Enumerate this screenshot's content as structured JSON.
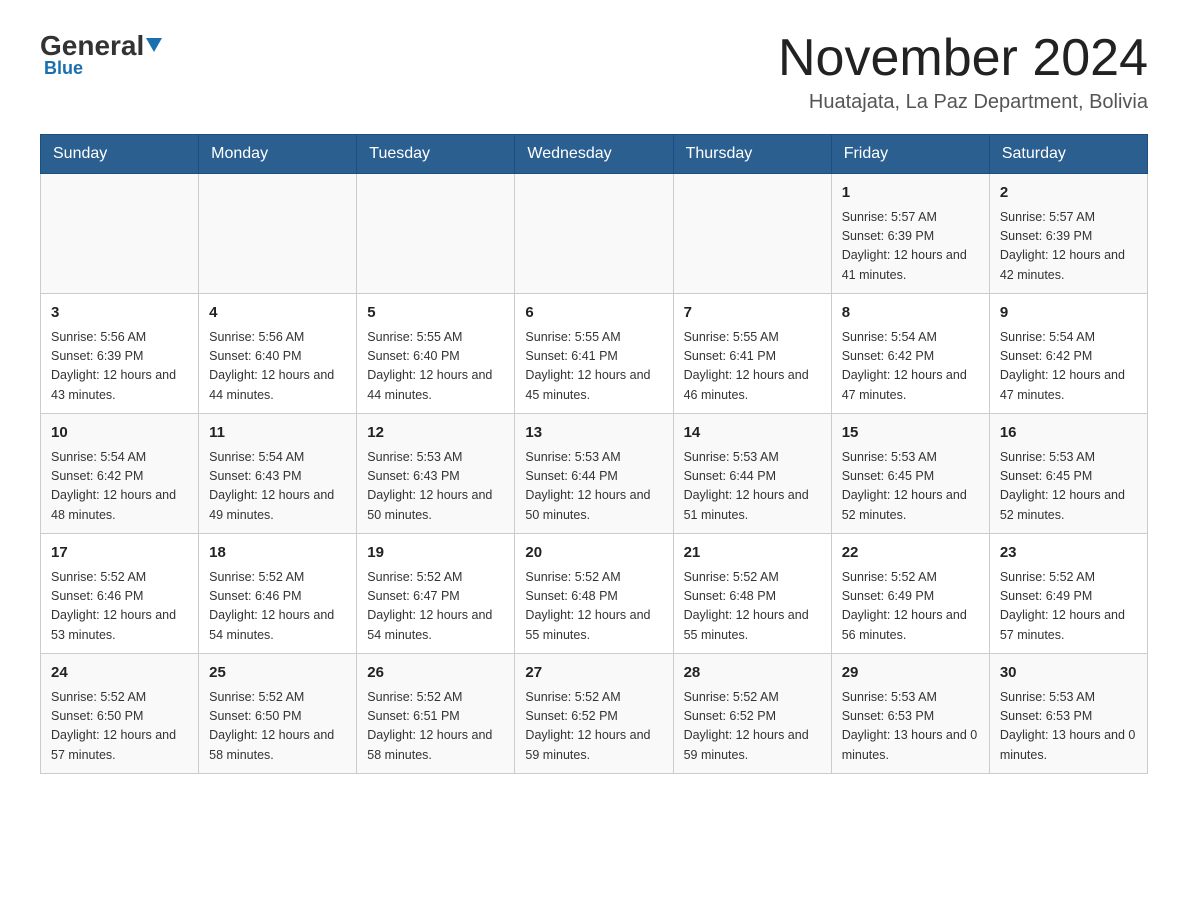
{
  "logo": {
    "text_general": "General",
    "text_blue": "Blue",
    "subtitle": "Blue"
  },
  "header": {
    "title": "November 2024",
    "subtitle": "Huatajata, La Paz Department, Bolivia"
  },
  "calendar": {
    "days_of_week": [
      "Sunday",
      "Monday",
      "Tuesday",
      "Wednesday",
      "Thursday",
      "Friday",
      "Saturday"
    ],
    "weeks": [
      [
        {
          "day": "",
          "info": ""
        },
        {
          "day": "",
          "info": ""
        },
        {
          "day": "",
          "info": ""
        },
        {
          "day": "",
          "info": ""
        },
        {
          "day": "",
          "info": ""
        },
        {
          "day": "1",
          "info": "Sunrise: 5:57 AM\nSunset: 6:39 PM\nDaylight: 12 hours and 41 minutes."
        },
        {
          "day": "2",
          "info": "Sunrise: 5:57 AM\nSunset: 6:39 PM\nDaylight: 12 hours and 42 minutes."
        }
      ],
      [
        {
          "day": "3",
          "info": "Sunrise: 5:56 AM\nSunset: 6:39 PM\nDaylight: 12 hours and 43 minutes."
        },
        {
          "day": "4",
          "info": "Sunrise: 5:56 AM\nSunset: 6:40 PM\nDaylight: 12 hours and 44 minutes."
        },
        {
          "day": "5",
          "info": "Sunrise: 5:55 AM\nSunset: 6:40 PM\nDaylight: 12 hours and 44 minutes."
        },
        {
          "day": "6",
          "info": "Sunrise: 5:55 AM\nSunset: 6:41 PM\nDaylight: 12 hours and 45 minutes."
        },
        {
          "day": "7",
          "info": "Sunrise: 5:55 AM\nSunset: 6:41 PM\nDaylight: 12 hours and 46 minutes."
        },
        {
          "day": "8",
          "info": "Sunrise: 5:54 AM\nSunset: 6:42 PM\nDaylight: 12 hours and 47 minutes."
        },
        {
          "day": "9",
          "info": "Sunrise: 5:54 AM\nSunset: 6:42 PM\nDaylight: 12 hours and 47 minutes."
        }
      ],
      [
        {
          "day": "10",
          "info": "Sunrise: 5:54 AM\nSunset: 6:42 PM\nDaylight: 12 hours and 48 minutes."
        },
        {
          "day": "11",
          "info": "Sunrise: 5:54 AM\nSunset: 6:43 PM\nDaylight: 12 hours and 49 minutes."
        },
        {
          "day": "12",
          "info": "Sunrise: 5:53 AM\nSunset: 6:43 PM\nDaylight: 12 hours and 50 minutes."
        },
        {
          "day": "13",
          "info": "Sunrise: 5:53 AM\nSunset: 6:44 PM\nDaylight: 12 hours and 50 minutes."
        },
        {
          "day": "14",
          "info": "Sunrise: 5:53 AM\nSunset: 6:44 PM\nDaylight: 12 hours and 51 minutes."
        },
        {
          "day": "15",
          "info": "Sunrise: 5:53 AM\nSunset: 6:45 PM\nDaylight: 12 hours and 52 minutes."
        },
        {
          "day": "16",
          "info": "Sunrise: 5:53 AM\nSunset: 6:45 PM\nDaylight: 12 hours and 52 minutes."
        }
      ],
      [
        {
          "day": "17",
          "info": "Sunrise: 5:52 AM\nSunset: 6:46 PM\nDaylight: 12 hours and 53 minutes."
        },
        {
          "day": "18",
          "info": "Sunrise: 5:52 AM\nSunset: 6:46 PM\nDaylight: 12 hours and 54 minutes."
        },
        {
          "day": "19",
          "info": "Sunrise: 5:52 AM\nSunset: 6:47 PM\nDaylight: 12 hours and 54 minutes."
        },
        {
          "day": "20",
          "info": "Sunrise: 5:52 AM\nSunset: 6:48 PM\nDaylight: 12 hours and 55 minutes."
        },
        {
          "day": "21",
          "info": "Sunrise: 5:52 AM\nSunset: 6:48 PM\nDaylight: 12 hours and 55 minutes."
        },
        {
          "day": "22",
          "info": "Sunrise: 5:52 AM\nSunset: 6:49 PM\nDaylight: 12 hours and 56 minutes."
        },
        {
          "day": "23",
          "info": "Sunrise: 5:52 AM\nSunset: 6:49 PM\nDaylight: 12 hours and 57 minutes."
        }
      ],
      [
        {
          "day": "24",
          "info": "Sunrise: 5:52 AM\nSunset: 6:50 PM\nDaylight: 12 hours and 57 minutes."
        },
        {
          "day": "25",
          "info": "Sunrise: 5:52 AM\nSunset: 6:50 PM\nDaylight: 12 hours and 58 minutes."
        },
        {
          "day": "26",
          "info": "Sunrise: 5:52 AM\nSunset: 6:51 PM\nDaylight: 12 hours and 58 minutes."
        },
        {
          "day": "27",
          "info": "Sunrise: 5:52 AM\nSunset: 6:52 PM\nDaylight: 12 hours and 59 minutes."
        },
        {
          "day": "28",
          "info": "Sunrise: 5:52 AM\nSunset: 6:52 PM\nDaylight: 12 hours and 59 minutes."
        },
        {
          "day": "29",
          "info": "Sunrise: 5:53 AM\nSunset: 6:53 PM\nDaylight: 13 hours and 0 minutes."
        },
        {
          "day": "30",
          "info": "Sunrise: 5:53 AM\nSunset: 6:53 PM\nDaylight: 13 hours and 0 minutes."
        }
      ]
    ]
  }
}
